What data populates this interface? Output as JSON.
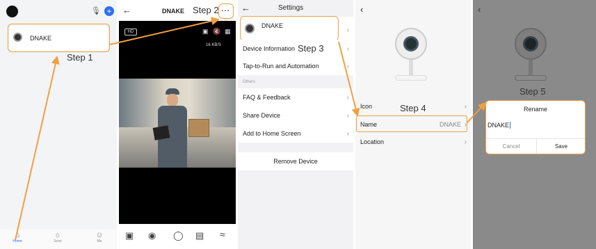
{
  "steps": {
    "step1": "Step 1",
    "step2": "Step 2",
    "step3": "Step 3",
    "step4": "Step 4",
    "step5": "Step 5"
  },
  "home": {
    "device_name": "DNAKE",
    "nav": [
      {
        "label": "Home",
        "icon": "home-icon"
      },
      {
        "label": "Scen",
        "icon": "scene-icon"
      },
      {
        "label": "Me",
        "icon": "profile-icon"
      }
    ]
  },
  "live": {
    "title": "DNAKE",
    "hd_badge": "HD",
    "speed": "16 KB/S",
    "controls": [
      "screenshot-icon",
      "camera-icon",
      "mic-icon",
      "record-icon",
      "more-controls-icon"
    ]
  },
  "settings": {
    "title": "Settings",
    "device_name": "DNAKE",
    "items_top": [
      "Device Information",
      "Tap-to-Run and Automation"
    ],
    "others_header": "Others",
    "items_others": [
      "FAQ & Feedback",
      "Share Device",
      "Add to Home Screen"
    ],
    "remove_label": "Remove Device"
  },
  "device_info": {
    "rows": [
      {
        "label": "Icon",
        "value": ""
      },
      {
        "label": "Name",
        "value": "DNAKE"
      },
      {
        "label": "Location",
        "value": ""
      }
    ]
  },
  "rename": {
    "title": "Rename",
    "input_value": "DNAKE",
    "cancel_label": "Cancel",
    "save_label": "Save"
  },
  "colors": {
    "accent_orange": "#f0a040",
    "blue": "#2e6ff2"
  }
}
